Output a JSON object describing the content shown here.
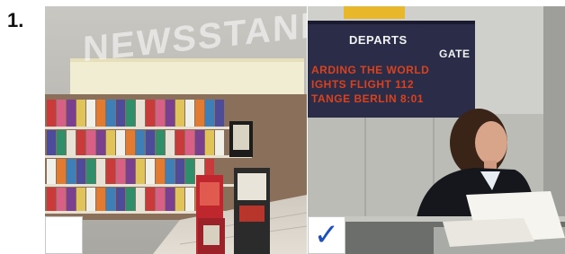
{
  "question": {
    "number": "1."
  },
  "left_photo": {
    "sign_text": "NEWSSTAND",
    "answer_checked": false
  },
  "right_photo": {
    "board": {
      "header_left": "DEPARTS",
      "header_right": "GATE",
      "rows": [
        "ARDING THE WORLD",
        "IGHTS FLIGHT 112",
        "TANGE BERLIN 8:01"
      ]
    },
    "answer_mark": "✓",
    "answer_checked": true
  },
  "colors": {
    "check_mark": "#1f4fbf",
    "board_text": "#d8421f",
    "board_bg": "#2a2c48"
  }
}
